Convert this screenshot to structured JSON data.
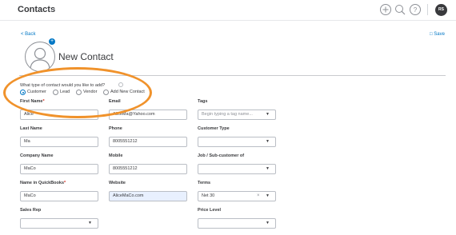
{
  "header": {
    "app_title": "Contacts",
    "avatar_initials": "RS"
  },
  "nav": {
    "back_label": "< Back",
    "save_label": "Save"
  },
  "page": {
    "title": "New Contact"
  },
  "contact_type": {
    "question": "What type of contact would you like to add?",
    "options": [
      "Customer",
      "Lead",
      "Vendor",
      "Add New Contact"
    ],
    "selected": "Customer"
  },
  "fields": {
    "first_name": {
      "label": "First Name",
      "value": "Alice"
    },
    "email": {
      "label": "Email",
      "value": "AliceMa@Yahoo.com"
    },
    "tags": {
      "label": "Tags",
      "placeholder": "Begin typing a tag name..."
    },
    "last_name": {
      "label": "Last Name",
      "value": "Ma"
    },
    "phone": {
      "label": "Phone",
      "value": "8005551212"
    },
    "customer_type": {
      "label": "Customer Type",
      "value": ""
    },
    "company_name": {
      "label": "Company Name",
      "value": "MaCo"
    },
    "mobile": {
      "label": "Mobile",
      "value": "8005551212"
    },
    "job_sub_customer": {
      "label": "Job / Sub-customer of",
      "value": ""
    },
    "name_in_qb": {
      "label": "Name in QuickBooks",
      "value": "MaCo"
    },
    "website": {
      "label": "Website",
      "value": "AliceMaCo.com"
    },
    "terms": {
      "label": "Terms",
      "value": "Net 30"
    },
    "sales_rep": {
      "label": "Sales Rep",
      "value": ""
    },
    "price_level": {
      "label": "Price Level",
      "value": ""
    }
  },
  "icons": {
    "add": "plus-circle-icon",
    "search": "search-icon",
    "help": "help-icon",
    "caret": "chevron-down-icon",
    "save": "save-icon",
    "avatar": "person-icon"
  },
  "colors": {
    "accent": "#0077c5",
    "annotation": "#f0922b",
    "required": "#d52b1e",
    "autofill": "#e8f0fe"
  }
}
